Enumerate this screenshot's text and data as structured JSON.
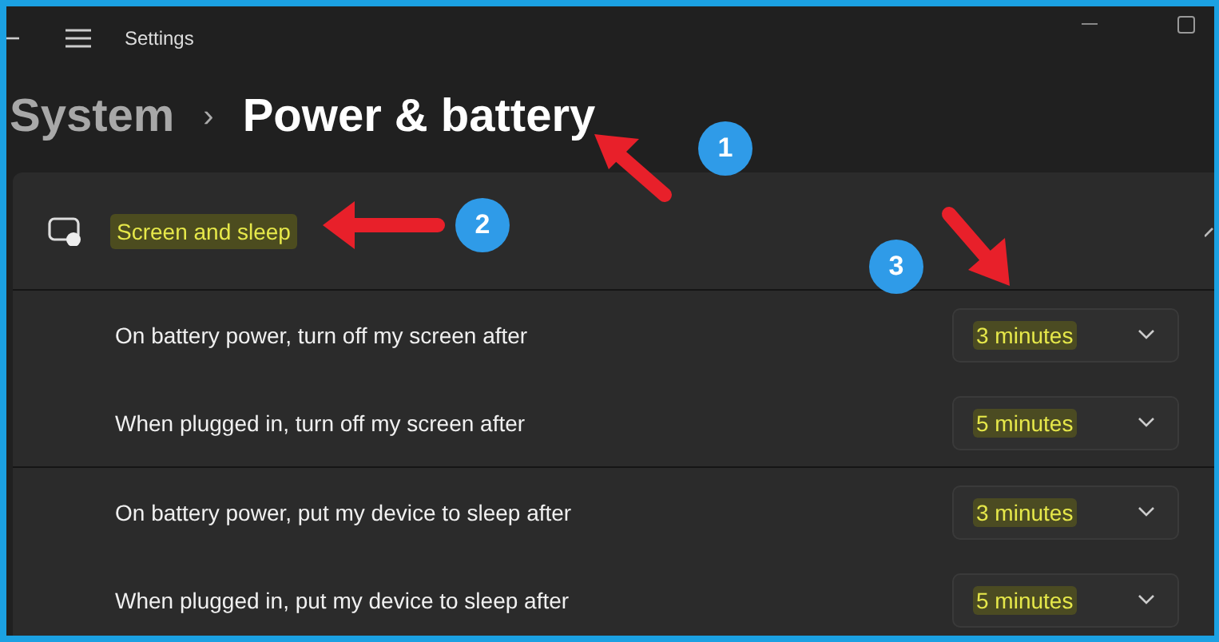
{
  "window": {
    "title": "Settings"
  },
  "breadcrumb": [
    {
      "label": "System",
      "current": false
    },
    {
      "label": "Power & battery",
      "current": true
    }
  ],
  "breadcrumb_separator": "›",
  "section": {
    "title": "Screen and sleep",
    "highlighted": true,
    "expanded": true
  },
  "setting_groups": [
    {
      "items": [
        {
          "label": "On battery power, turn off my screen after",
          "value": "3 minutes",
          "highlighted": true
        },
        {
          "label": "When plugged in, turn off my screen after",
          "value": "5 minutes",
          "highlighted": true
        }
      ]
    },
    {
      "items": [
        {
          "label": "On battery power, put my device to sleep after",
          "value": "3 minutes",
          "highlighted": true
        },
        {
          "label": "When plugged in, put my device to sleep after",
          "value": "5 minutes",
          "highlighted": true
        }
      ]
    }
  ],
  "annotations": [
    {
      "number": "1"
    },
    {
      "number": "2"
    },
    {
      "number": "3"
    }
  ]
}
